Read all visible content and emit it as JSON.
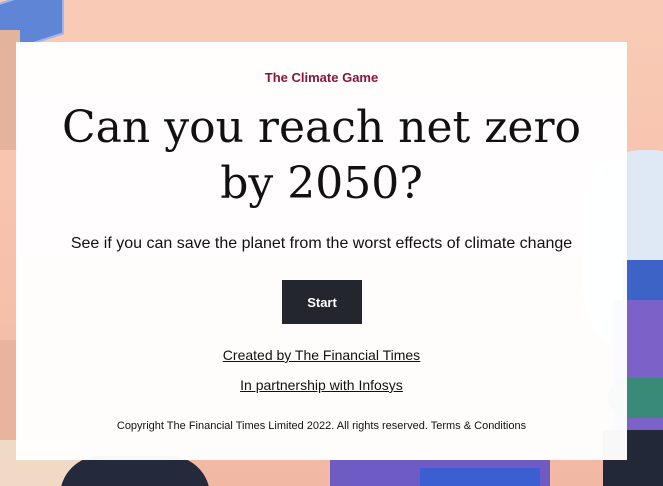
{
  "label": "The Climate Game",
  "headline_line1": "Can you reach net zero",
  "headline_line2": "by 2050?",
  "subtitle": "See if you can save the planet from the worst effects of climate change",
  "start_label": "Start",
  "link_created": "Created by The Financial Times",
  "link_partner": "In partnership with Infosys",
  "copyright": "Copyright The Financial Times Limited 2022. All rights reserved.",
  "terms_label": "Terms & Conditions",
  "colors": {
    "label": "#8a1538",
    "button_bg": "#23262d",
    "background": "#f7c3ad"
  }
}
